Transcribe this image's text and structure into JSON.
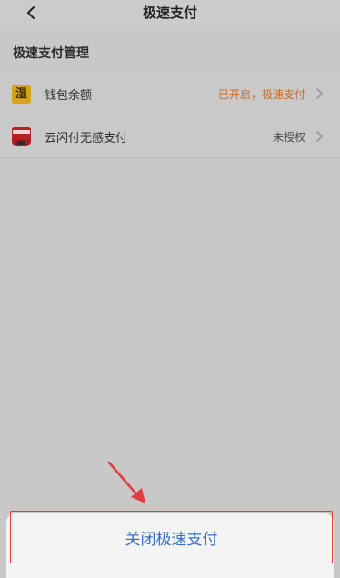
{
  "header": {
    "title": "极速支付",
    "back_icon": "chevron-left-icon"
  },
  "section": {
    "title": "极速支付管理"
  },
  "items": [
    {
      "label": "钱包余额",
      "status": "已开启，极速支付",
      "icon": "wallet-icon",
      "icon_glyph": "湿",
      "status_color": "#c56a2b"
    },
    {
      "label": "云闪付无感支付",
      "status": "未授权",
      "icon": "quickpass-icon"
    }
  ],
  "action": {
    "close_label": "关闭极速支付",
    "highlight_color": "#e23b3b",
    "label_color": "#3a6fc4"
  }
}
